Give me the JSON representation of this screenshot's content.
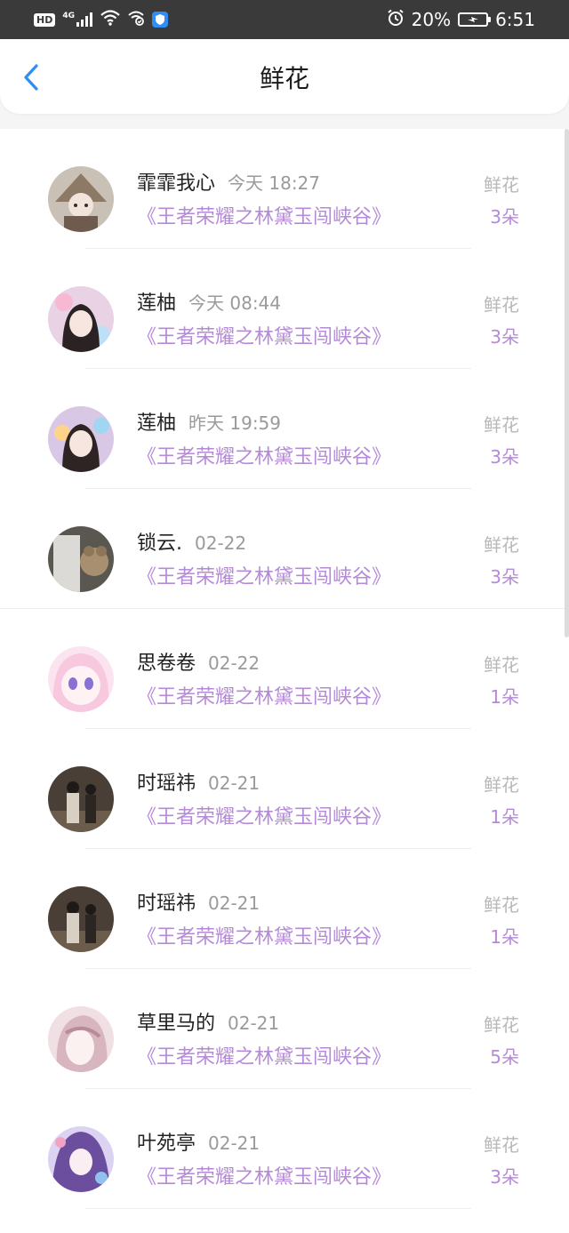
{
  "status_bar": {
    "hd": "HD",
    "network": "4G",
    "battery_pct": "20%",
    "time": "6:51",
    "icons": [
      "hd-icon",
      "signal-icon",
      "wifi-icon",
      "hotspot-icon",
      "shield-icon",
      "alarm-icon",
      "battery-charging-icon"
    ]
  },
  "header": {
    "title": "鲜花",
    "back_icon": "chevron-left-icon"
  },
  "colors": {
    "accent": "#b58ad8",
    "back": "#2e8ef5",
    "muted": "#9a9a9a"
  },
  "gifts": [
    {
      "name": "霏霏我心",
      "time": "今天 18:27",
      "book": "《王者荣耀之林黛玉闯峡谷》",
      "gift": "鲜花",
      "count": "3朵"
    },
    {
      "name": "莲柚",
      "time": "今天 08:44",
      "book": "《王者荣耀之林黛玉闯峡谷》",
      "gift": "鲜花",
      "count": "3朵"
    },
    {
      "name": "莲柚",
      "time": "昨天 19:59",
      "book": "《王者荣耀之林黛玉闯峡谷》",
      "gift": "鲜花",
      "count": "3朵"
    },
    {
      "name": "锁云.",
      "time": "02-22",
      "book": "《王者荣耀之林黛玉闯峡谷》",
      "gift": "鲜花",
      "count": "3朵"
    },
    {
      "name": "思卷卷",
      "time": "02-22",
      "book": "《王者荣耀之林黛玉闯峡谷》",
      "gift": "鲜花",
      "count": "1朵"
    },
    {
      "name": "时瑶祎",
      "time": "02-21",
      "book": "《王者荣耀之林黛玉闯峡谷》",
      "gift": "鲜花",
      "count": "1朵"
    },
    {
      "name": "时瑶祎",
      "time": "02-21",
      "book": "《王者荣耀之林黛玉闯峡谷》",
      "gift": "鲜花",
      "count": "1朵"
    },
    {
      "name": "草里马的",
      "time": "02-21",
      "book": "《王者荣耀之林黛玉闯峡谷》",
      "gift": "鲜花",
      "count": "5朵"
    },
    {
      "name": "叶苑亭",
      "time": "02-21",
      "book": "《王者荣耀之林黛玉闯峡谷》",
      "gift": "鲜花",
      "count": "3朵"
    }
  ]
}
